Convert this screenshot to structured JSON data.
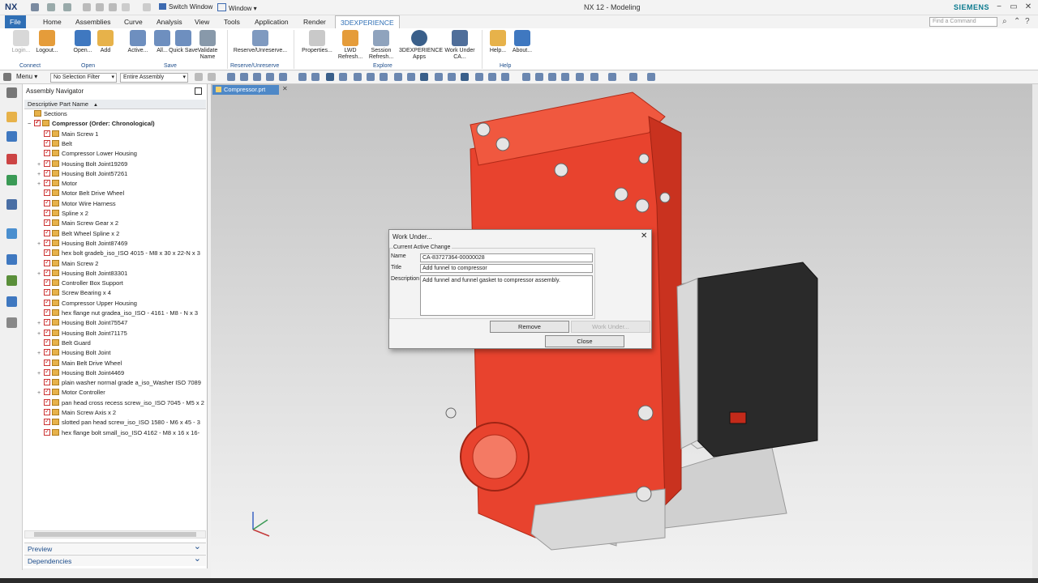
{
  "app": {
    "logo": "NX",
    "title": "NX 12 - Modeling",
    "brand": "SIEMENS",
    "switch_window": "Switch Window",
    "window": "Window ▾"
  },
  "menu_tabs": [
    "File",
    "Home",
    "Assemblies",
    "Curve",
    "Analysis",
    "View",
    "Tools",
    "Application",
    "Render",
    "3DEXPERIENCE"
  ],
  "command_search_placeholder": "Find a Command",
  "ribbon": {
    "buttons": [
      {
        "label": "Login...",
        "disabled": true
      },
      {
        "label": "Logout...",
        "disabled": false
      },
      {
        "label": "Open...",
        "disabled": false
      },
      {
        "label": "Add",
        "disabled": false
      },
      {
        "label": "Active...",
        "disabled": false
      },
      {
        "label": "All...",
        "disabled": false
      },
      {
        "label": "Quick Save",
        "disabled": false
      },
      {
        "label": "Validate Name",
        "disabled": false
      },
      {
        "label": "Reserve/Unreserve...",
        "disabled": false
      },
      {
        "label": "Properties...",
        "disabled": false
      },
      {
        "label": "LWD Refresh...",
        "disabled": false
      },
      {
        "label": "Session Refresh...",
        "disabled": false
      },
      {
        "label": "3DEXPERIENCE Apps",
        "disabled": false
      },
      {
        "label": "Work Under CA...",
        "disabled": false
      },
      {
        "label": "Help...",
        "disabled": false
      },
      {
        "label": "About...",
        "disabled": false
      }
    ],
    "groups": [
      "Connect",
      "Open",
      "Save",
      "Reserve/Unreserve",
      "Explore",
      "Help"
    ]
  },
  "toolbar": {
    "menu_label": "Menu ▾",
    "selection_filter": "No Selection Filter",
    "scope": "Entire Assembly"
  },
  "navigator": {
    "title": "Assembly Navigator",
    "column_header": "Descriptive Part Name",
    "rows": [
      {
        "label": "Sections",
        "level": 1,
        "expand": "",
        "check": false,
        "bold": false
      },
      {
        "label": "Compressor (Order: Chronological)",
        "level": 1,
        "expand": "−",
        "check": true,
        "bold": true
      },
      {
        "label": "Main Screw 1",
        "level": 2,
        "expand": "",
        "check": true,
        "bold": false
      },
      {
        "label": "Belt",
        "level": 2,
        "expand": "",
        "check": true,
        "bold": false
      },
      {
        "label": "Compressor Lower Housing",
        "level": 2,
        "expand": "",
        "check": true,
        "bold": false
      },
      {
        "label": "Housing Bolt Joint19269",
        "level": 2,
        "expand": "+",
        "check": true,
        "bold": false
      },
      {
        "label": "Housing Bolt Joint57261",
        "level": 2,
        "expand": "+",
        "check": true,
        "bold": false
      },
      {
        "label": "Motor",
        "level": 2,
        "expand": "+",
        "check": true,
        "bold": false
      },
      {
        "label": "Motor Belt Drive Wheel",
        "level": 2,
        "expand": "",
        "check": true,
        "bold": false
      },
      {
        "label": "Motor Wire Harness",
        "level": 2,
        "expand": "",
        "check": true,
        "bold": false
      },
      {
        "label": "Spline x 2",
        "level": 2,
        "expand": "",
        "check": true,
        "bold": false
      },
      {
        "label": "Main Screw Gear x 2",
        "level": 2,
        "expand": "",
        "check": true,
        "bold": false
      },
      {
        "label": "Belt Wheel Spline x 2",
        "level": 2,
        "expand": "",
        "check": true,
        "bold": false
      },
      {
        "label": "Housing Bolt Joint87469",
        "level": 2,
        "expand": "+",
        "check": true,
        "bold": false
      },
      {
        "label": "hex bolt gradeb_iso_ISO 4015 - M8 x 30 x 22-N x 3",
        "level": 2,
        "expand": "",
        "check": true,
        "bold": false
      },
      {
        "label": "Main Screw 2",
        "level": 2,
        "expand": "",
        "check": true,
        "bold": false
      },
      {
        "label": "Housing Bolt Joint83301",
        "level": 2,
        "expand": "+",
        "check": true,
        "bold": false
      },
      {
        "label": "Controller Box Support",
        "level": 2,
        "expand": "",
        "check": true,
        "bold": false
      },
      {
        "label": "Screw Bearing x 4",
        "level": 2,
        "expand": "",
        "check": true,
        "bold": false
      },
      {
        "label": "Compressor Upper Housing",
        "level": 2,
        "expand": "",
        "check": true,
        "bold": false
      },
      {
        "label": "hex flange nut gradea_iso_ISO - 4161 - M8 - N x 3",
        "level": 2,
        "expand": "",
        "check": true,
        "bold": false
      },
      {
        "label": "Housing Bolt Joint75547",
        "level": 2,
        "expand": "+",
        "check": true,
        "bold": false
      },
      {
        "label": "Housing Bolt Joint71175",
        "level": 2,
        "expand": "+",
        "check": true,
        "bold": false
      },
      {
        "label": "Belt Guard",
        "level": 2,
        "expand": "",
        "check": true,
        "bold": false
      },
      {
        "label": "Housing Bolt Joint",
        "level": 2,
        "expand": "+",
        "check": true,
        "bold": false
      },
      {
        "label": "Main Belt Drive Wheel",
        "level": 2,
        "expand": "",
        "check": true,
        "bold": false
      },
      {
        "label": "Housing Bolt Joint4469",
        "level": 2,
        "expand": "+",
        "check": true,
        "bold": false
      },
      {
        "label": "plain washer normal grade a_iso_Washer ISO 7089",
        "level": 2,
        "expand": "",
        "check": true,
        "bold": false
      },
      {
        "label": "Motor Controller",
        "level": 2,
        "expand": "+",
        "check": true,
        "bold": false
      },
      {
        "label": "pan head cross recess screw_iso_ISO 7045 - M5 x 2",
        "level": 2,
        "expand": "",
        "check": true,
        "bold": false
      },
      {
        "label": "Main Screw Axis x 2",
        "level": 2,
        "expand": "",
        "check": true,
        "bold": false
      },
      {
        "label": "slotted pan head screw_iso_ISO 1580 - M6 x 45 - 3",
        "level": 2,
        "expand": "",
        "check": true,
        "bold": false
      },
      {
        "label": "hex flange bolt small_iso_ISO 4162 - M8 x 16 x 16-",
        "level": 2,
        "expand": "",
        "check": true,
        "bold": false
      }
    ],
    "panels": [
      "Preview",
      "Dependencies"
    ]
  },
  "graphics": {
    "tab_label": "Compressor.prt"
  },
  "dialog": {
    "title": "Work Under...",
    "group_label": "Current Active Change",
    "name_label": "Name",
    "name_value": "CA-83727364-00000028",
    "title_label": "Title",
    "title_value": "Add funnel to compressor",
    "description_label": "Description",
    "description_value": "Add funnel and funnel gasket to compressor assembly.",
    "remove_label": "Remove",
    "work_under_label": "Work Under...",
    "close_label": "Close"
  },
  "colors": {
    "accent": "#2f6fb5",
    "part_red": "#e8432e",
    "controller_black": "#2a2a2a",
    "brand_teal": "#0b7a8f"
  }
}
